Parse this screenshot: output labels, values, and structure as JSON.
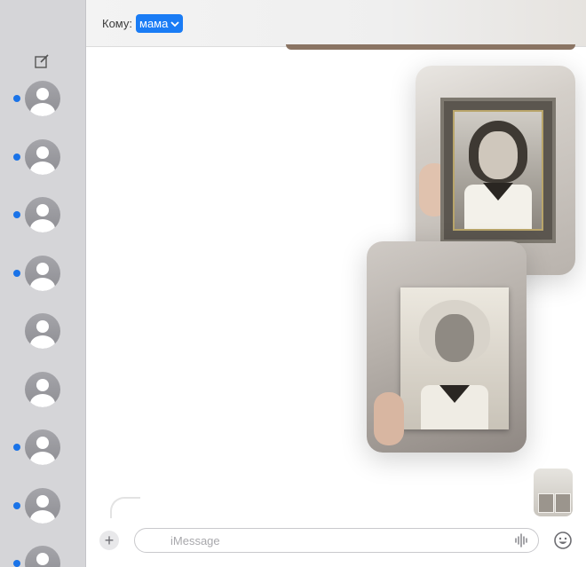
{
  "sidebar": {
    "compose_icon": "compose-icon",
    "conversations": [
      {
        "unread": true
      },
      {
        "unread": true
      },
      {
        "unread": true
      },
      {
        "unread": true
      },
      {
        "unread": false
      },
      {
        "unread": false
      },
      {
        "unread": true
      },
      {
        "unread": true
      },
      {
        "unread": true
      }
    ]
  },
  "header": {
    "to_label": "Кому:",
    "recipient": "мама"
  },
  "composer": {
    "add_icon": "+",
    "placeholder": "iMessage",
    "audio_icon": "waveform-icon",
    "emoji_icon": "emoji-icon"
  },
  "colors": {
    "accent": "#1a7cf5",
    "unread_dot": "#1a73e8",
    "sidebar_bg": "#d5d5d8"
  }
}
